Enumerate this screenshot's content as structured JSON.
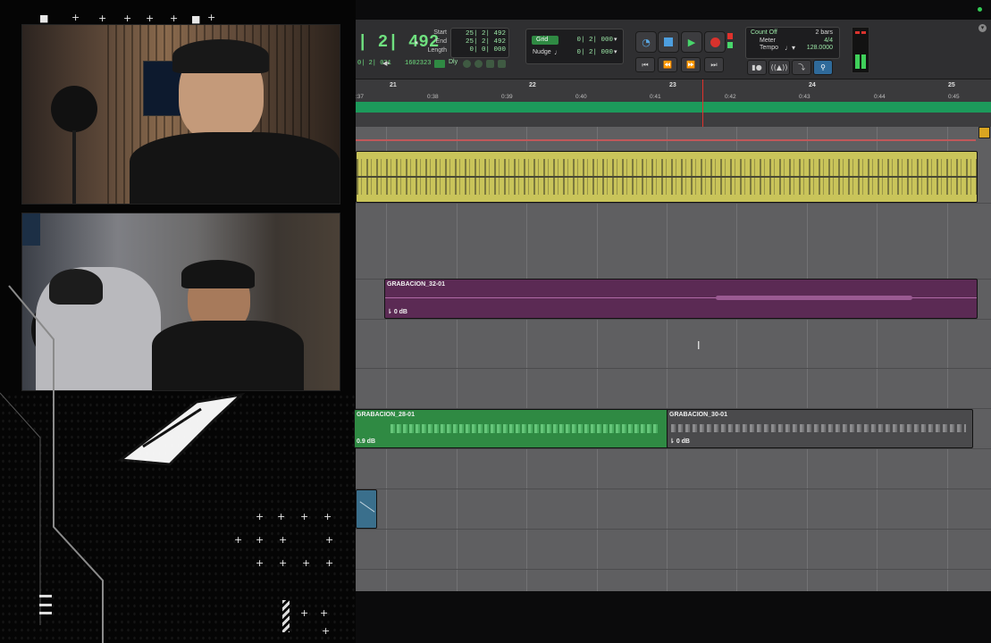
{
  "daw": {
    "counter_main": "| 2| 492",
    "sub_counter": "0| 2| 031",
    "samples": "1602323",
    "dly_label": "Dly",
    "start_label": "Start",
    "end_label": "End",
    "length_label": "Length",
    "start_value": "25| 2| 492",
    "end_value": "25| 2| 492",
    "length_value": "0| 0| 000",
    "grid_label": "Grid",
    "grid_value": "0| 2| 000",
    "nudge_label": "Nudge",
    "nudge_value": "0| 2| 000",
    "count_off": "Count Off",
    "count_bars": "2 bars",
    "meter_label": "Meter",
    "meter_value": "4/4",
    "tempo_label": "Tempo",
    "tempo_value": "128.0000",
    "bars": [
      "21",
      "22",
      "23",
      "24",
      "25"
    ],
    "times": [
      ":37",
      "0:38",
      "0:39",
      "0:40",
      "0:41",
      "0:42",
      "0:43",
      "0:44",
      "0:45"
    ],
    "clips": [
      {
        "name": "GRABACION_32-01",
        "gain": "0 dB"
      },
      {
        "name": "GRABACION_28-01",
        "gain": "0.9 dB"
      },
      {
        "name": "GRABACION_30-01",
        "gain": "0 dB"
      }
    ]
  },
  "colors": {
    "audio_yellow": "#c9c45a",
    "clip_purple": "#5b2a54",
    "clip_green": "#2f8a43",
    "clip_gray": "#4a4a4c",
    "playhead": "#e0322c",
    "timeline_green": "#1c9a5b"
  },
  "icons": [
    "rewind-icon",
    "fast-forward-icon",
    "stop-icon",
    "play-icon",
    "record-icon",
    "loop-icon",
    "cursor-ibeam-icon",
    "menu-icon"
  ]
}
